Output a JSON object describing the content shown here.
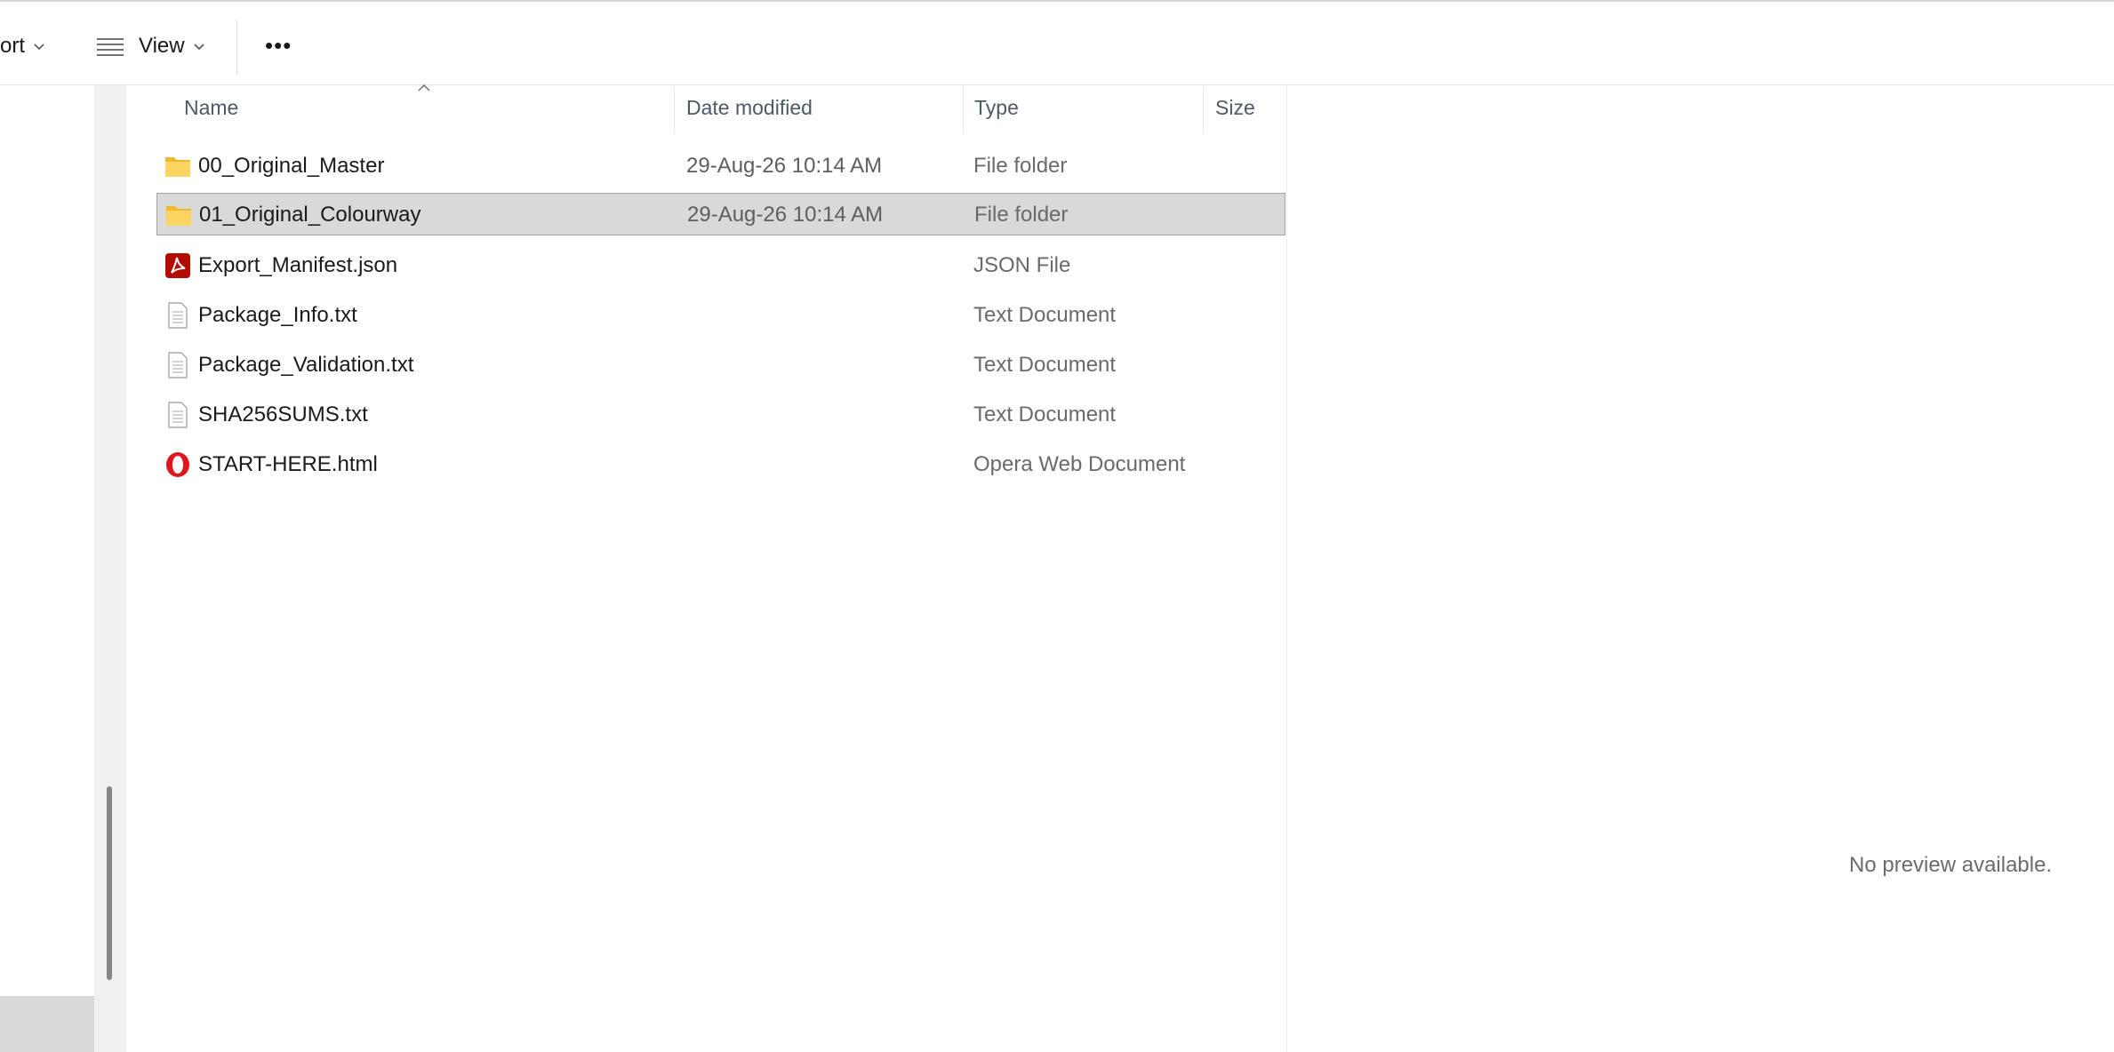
{
  "toolbar": {
    "sort_label": "ort",
    "view_label": "View",
    "more_label": "•••"
  },
  "columns": {
    "name": "Name",
    "date_modified": "Date modified",
    "type": "Type",
    "size": "Size"
  },
  "files": [
    {
      "name": "00_Original_Master",
      "date": "29-Aug-26 10:14 AM",
      "type": "File folder",
      "icon": "folder-icon",
      "selected": false
    },
    {
      "name": "01_Original_Colourway",
      "date": "29-Aug-26 10:14 AM",
      "type": "File folder",
      "icon": "folder-icon",
      "selected": true
    },
    {
      "name": "Export_Manifest.json",
      "date": "",
      "type": "JSON File",
      "icon": "pdf-app-icon",
      "selected": false
    },
    {
      "name": "Package_Info.txt",
      "date": "",
      "type": "Text Document",
      "icon": "text-document-icon",
      "selected": false
    },
    {
      "name": "Package_Validation.txt",
      "date": "",
      "type": "Text Document",
      "icon": "text-document-icon",
      "selected": false
    },
    {
      "name": "SHA256SUMS.txt",
      "date": "",
      "type": "Text Document",
      "icon": "text-document-icon",
      "selected": false
    },
    {
      "name": "START-HERE.html",
      "date": "",
      "type": "Opera Web Document",
      "icon": "opera-icon",
      "selected": false
    }
  ],
  "preview": {
    "message": "No preview available."
  },
  "colors": {
    "selection": "#d9d9d9",
    "folder": "#f8c93e",
    "pdf_red": "#b30b00",
    "opera_red": "#e0161e"
  }
}
